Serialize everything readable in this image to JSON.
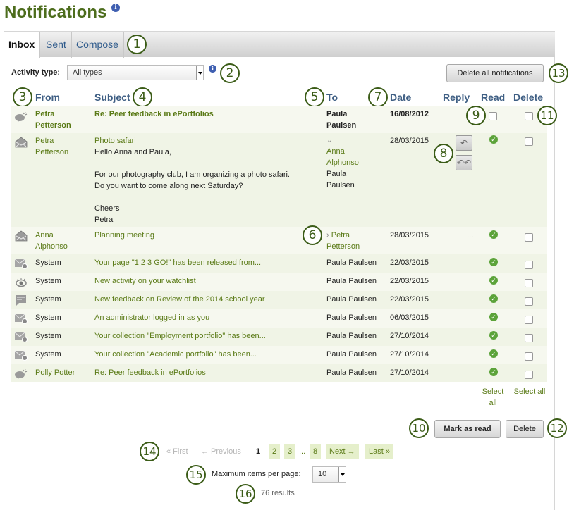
{
  "page": {
    "title": "Notifications",
    "title_info_icon": "info-icon"
  },
  "tabs": [
    {
      "label": "Inbox",
      "active": true
    },
    {
      "label": "Sent",
      "active": false
    },
    {
      "label": "Compose",
      "active": false
    }
  ],
  "filter": {
    "label": "Activity type:",
    "selected": "All types",
    "info_icon": "info-icon"
  },
  "delete_all_label": "Delete all notifications",
  "columns": {
    "from": "From",
    "subject": "Subject",
    "to": "To",
    "date": "Date",
    "reply": "Reply",
    "read": "Read",
    "delete": "Delete"
  },
  "rows": [
    {
      "icon": "feedback-bubble-icon",
      "from_line1": "Petra",
      "from_line2": "Petterson",
      "subject": "Re: Peer feedback in ePortfolios",
      "to_line1": "Paula",
      "to_line2": "Paulsen",
      "date": "16/08/2012",
      "unread": true
    },
    {
      "icon": "envelope-open-icon",
      "from_line1": "Petra",
      "from_line2": "Petterson",
      "subject": "Photo safari",
      "body": [
        "Hello Anna and Paula,",
        "",
        "For our photography club, I am organizing a photo safari.",
        "Do you want to come along next Saturday?",
        "",
        "Cheers",
        "Petra"
      ],
      "to_expanded": [
        "Anna",
        "Alphonso",
        "Paula",
        "Paulsen"
      ],
      "date": "28/03/2015",
      "reply_label": "Reply",
      "reply_all_label": "Reply all",
      "read": true
    },
    {
      "icon": "envelope-open-icon",
      "from_line1": "Anna",
      "from_line2": "Alphonso",
      "subject": "Planning meeting",
      "to_line1": "Petra",
      "to_line2": "Petterson",
      "date": "28/03/2015",
      "reply": "...",
      "read": true
    },
    {
      "icon": "system-mail-gear-icon",
      "from": "System",
      "subject": "Your page \"1 2 3 GO!\" has been released from...",
      "to": "Paula Paulsen",
      "date": "22/03/2015",
      "read": true
    },
    {
      "icon": "watchlist-eye-icon",
      "from": "System",
      "subject": "New activity on your watchlist",
      "to": "Paula Paulsen",
      "date": "22/03/2015",
      "read": true
    },
    {
      "icon": "feedback-comment-icon",
      "from": "System",
      "subject": "New feedback on Review of the 2014 school year",
      "to": "Paula Paulsen",
      "date": "22/03/2015",
      "read": true
    },
    {
      "icon": "system-mail-gear-icon",
      "from": "System",
      "subject": "An administrator logged in as you",
      "to": "Paula Paulsen",
      "date": "06/03/2015",
      "read": true
    },
    {
      "icon": "system-mail-gear-icon",
      "from": "System",
      "subject": "Your collection \"Employment portfolio\" has been...",
      "to": "Paula Paulsen",
      "date": "27/10/2014",
      "read": true
    },
    {
      "icon": "system-mail-gear-icon",
      "from": "System",
      "subject": "Your collection \"Academic portfolio\" has been...",
      "to": "Paula Paulsen",
      "date": "27/10/2014",
      "read": true
    },
    {
      "icon": "feedback-bubble-icon",
      "from": "Polly Potter",
      "subject": "Re: Peer feedback in ePortfolios",
      "to": "Paula Paulsen",
      "date": "27/10/2014",
      "read": true
    }
  ],
  "select_all": {
    "read_line1": "Select",
    "read_line2": "all",
    "delete": "Select all"
  },
  "actions": {
    "mark_as_read": "Mark as read",
    "delete": "Delete"
  },
  "pagination": {
    "first": "« First",
    "previous": "← Previous",
    "current": "1",
    "pages": [
      "2",
      "3"
    ],
    "ellipsis": "...",
    "last_page": "8",
    "next": "Next →",
    "last": "Last »"
  },
  "per_page": {
    "label": "Maximum items per page:",
    "selected": "10"
  },
  "results": "76 results",
  "callouts": [
    "1",
    "2",
    "3",
    "4",
    "5",
    "6",
    "7",
    "8",
    "9",
    "10",
    "11",
    "12",
    "13",
    "14",
    "15",
    "16"
  ]
}
